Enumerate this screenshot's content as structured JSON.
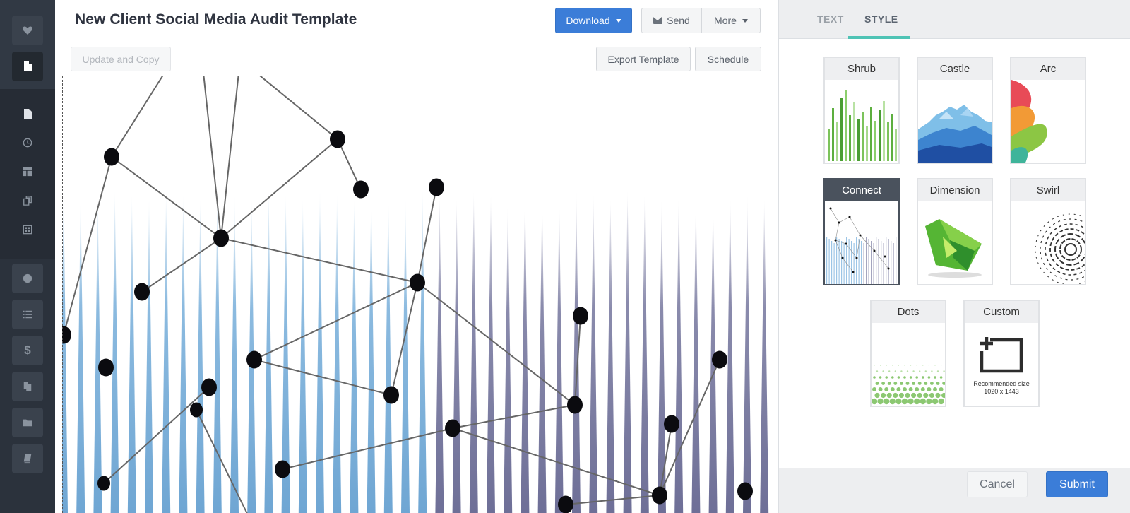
{
  "document": {
    "title": "New Client Social Media Audit Template"
  },
  "toolbar": {
    "download_label": "Download",
    "send_label": "Send",
    "more_label": "More",
    "update_copy_label": "Update and Copy",
    "export_template_label": "Export Template",
    "schedule_label": "Schedule"
  },
  "sidebar": {
    "icons": [
      "heart-icon",
      "document-icon",
      "document-icon",
      "clock-icon",
      "layout-icon",
      "copy-icon",
      "grid-icon",
      "globe-icon",
      "list-icon",
      "dollar-icon",
      "documents-icon",
      "folder-icon",
      "book-icon"
    ]
  },
  "panel": {
    "tabs": [
      "TEXT",
      "STYLE"
    ],
    "active_tab": "STYLE",
    "styles": [
      {
        "label": "Shrub"
      },
      {
        "label": "Castle"
      },
      {
        "label": "Arc"
      },
      {
        "label": "Connect"
      },
      {
        "label": "Dimension"
      },
      {
        "label": "Swirl"
      },
      {
        "label": "Dots"
      },
      {
        "label": "Custom"
      }
    ],
    "selected_style": "Connect",
    "custom_hint_line1": "Recommended size",
    "custom_hint_line2": "1020 x 1443",
    "cancel_label": "Cancel",
    "submit_label": "Submit"
  },
  "colors": {
    "accent": "#3b7dd8",
    "tab_underline": "#4fc3b5",
    "sidebar_bg": "#2b323c",
    "spike_blue": "#7fb3dc",
    "spike_purple": "#7d7ea3"
  }
}
